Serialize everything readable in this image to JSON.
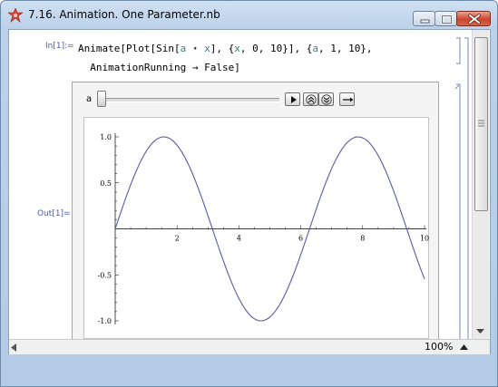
{
  "window": {
    "title": "7.16. Animation. One Parameter.nb",
    "accent": "#c0392b"
  },
  "cell_input": {
    "label": "In[1]:=",
    "line1": {
      "a": "Animate[Plot[Sin[",
      "b": "a",
      "c": " ⋆ ",
      "d": "x",
      "e": "], {",
      "f": "x",
      "g": ", 0, 10}], {",
      "h": "a",
      "i": ", 1, 10},"
    },
    "line2": "AnimationRunning → False]"
  },
  "cell_output": {
    "label": "Out[1]=",
    "variable_label": "a",
    "slider_value": 1,
    "controls": [
      "play-button",
      "faster-button",
      "slower-button",
      "direction-button"
    ]
  },
  "chart_data": {
    "type": "line",
    "title": "",
    "xlabel": "",
    "ylabel": "",
    "function": "Sin[a x]",
    "a": 1,
    "xlim": [
      0,
      10
    ],
    "ylim": [
      -1,
      1
    ],
    "xticks": [
      "2",
      "4",
      "6",
      "8",
      "10"
    ],
    "yticks": [
      "1.0",
      "0.5",
      "-0.5",
      "-1.0"
    ],
    "x": [
      0,
      0.5,
      1,
      1.5,
      2,
      2.5,
      3,
      3.5,
      4,
      4.5,
      5,
      5.5,
      6,
      6.5,
      7,
      7.5,
      8,
      8.5,
      9,
      9.5,
      10
    ],
    "y": [
      0,
      0.48,
      0.84,
      1.0,
      0.91,
      0.6,
      0.14,
      -0.35,
      -0.76,
      -0.98,
      -0.96,
      -0.71,
      -0.28,
      0.22,
      0.66,
      0.94,
      0.99,
      0.8,
      0.41,
      -0.08,
      -0.54
    ],
    "grid": false,
    "color": "#5a5aa8"
  },
  "statusbar": {
    "zoom": "100%"
  }
}
